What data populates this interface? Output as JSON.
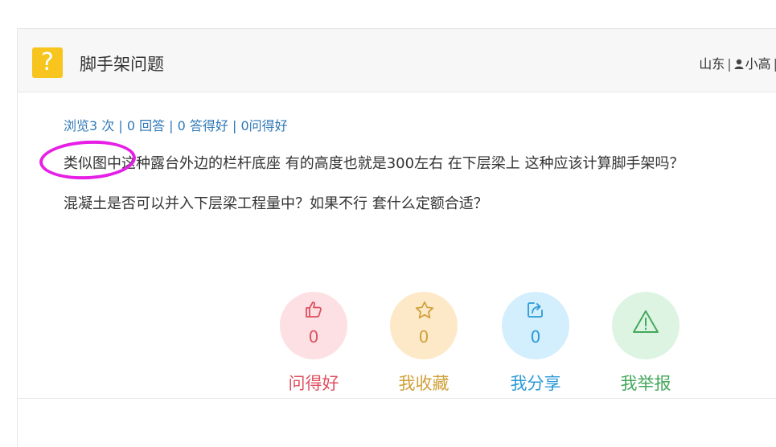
{
  "question": {
    "badge_glyph": "?",
    "title": "脚手架问题",
    "location": "山东",
    "user": "小高",
    "separator": "|",
    "stats": "浏览3 次 | 0 回答 | 0 答得好 | 0问得好",
    "body_line1": "类似图中这种露台外边的栏杆底座 有的高度也就是300左右 在下层梁上 这种应该计算脚手架吗？",
    "body_line2": "混凝土是否可以并入下层梁工程量中？如果不行 套什么定额合适？"
  },
  "actions": {
    "like": {
      "count": "0",
      "label": "问得好",
      "icon": "thumbs-up-icon",
      "color": "#e0505f"
    },
    "favorite": {
      "count": "0",
      "label": "我收藏",
      "icon": "star-icon",
      "color": "#d0a03a"
    },
    "share": {
      "count": "0",
      "label": "我分享",
      "icon": "share-icon",
      "color": "#2a9ad6"
    },
    "report": {
      "label": "我举报",
      "icon": "warning-icon",
      "color": "#45a85c"
    }
  },
  "annotation": {
    "color": "#e61ee6",
    "shape": "ellipse"
  }
}
